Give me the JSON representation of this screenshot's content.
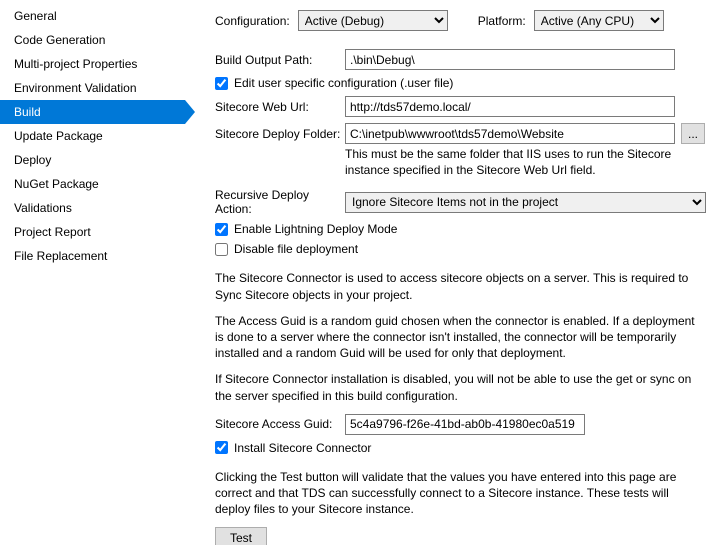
{
  "sidebar": {
    "items": [
      {
        "label": "General"
      },
      {
        "label": "Code Generation"
      },
      {
        "label": "Multi-project Properties"
      },
      {
        "label": "Environment Validation"
      },
      {
        "label": "Build"
      },
      {
        "label": "Update Package"
      },
      {
        "label": "Deploy"
      },
      {
        "label": "NuGet Package"
      },
      {
        "label": "Validations"
      },
      {
        "label": "Project Report"
      },
      {
        "label": "File Replacement"
      }
    ]
  },
  "top": {
    "configLabel": "Configuration:",
    "configValue": "Active (Debug)",
    "platformLabel": "Platform:",
    "platformValue": "Active (Any CPU)"
  },
  "fields": {
    "buildOutputLabel": "Build Output Path:",
    "buildOutputValue": ".\\bin\\Debug\\",
    "editUserConfig": "Edit user specific configuration (.user file)",
    "sitecoreWebUrlLabel": "Sitecore Web Url:",
    "sitecoreWebUrlValue": "http://tds57demo.local/",
    "sitecoreDeployFolderLabel": "Sitecore Deploy Folder:",
    "sitecoreDeployFolderValue": "C:\\inetpub\\wwwroot\\tds57demo\\Website",
    "browseBtn": "...",
    "deployFolderHint": "This must be the same folder that IIS uses to run the Sitecore instance specified in the Sitecore Web Url field.",
    "recursiveDeployLabel": "Recursive Deploy Action:",
    "recursiveDeployValue": "Ignore Sitecore Items not in the project",
    "enableLightning": "Enable Lightning Deploy Mode",
    "disableFileDeploy": "Disable file deployment",
    "connectorPara": "The Sitecore Connector is used to access sitecore objects on a server. This is required to Sync Sitecore objects in your project.",
    "accessGuidPara": "The Access Guid is a random guid chosen when the connector is enabled. If a deployment is done to a server where the connector isn't installed, the connector will be temporarily installed and a random Guid will be used for only that deployment.",
    "installDisabledPara": "If Sitecore Connector installation is disabled, you will not be able to use the get or sync on the server specified in this build configuration.",
    "accessGuidLabel": "Sitecore Access Guid:",
    "accessGuidValue": "5c4a9796-f26e-41bd-ab0b-41980ec0a519",
    "installConnector": "Install Sitecore Connector",
    "testPara": "Clicking the Test button will validate that the values you have entered into this page are correct and that TDS can successfully connect to a Sitecore instance. These tests will deploy files to your Sitecore instance.",
    "testBtn": "Test"
  }
}
